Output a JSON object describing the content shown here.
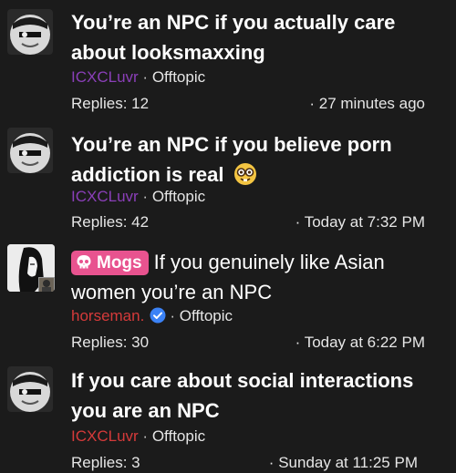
{
  "threads": [
    {
      "title": "You’re an NPC if you actually care about looksmaxxing",
      "author": "ICXCLuvr",
      "forum": "Offtopic",
      "replies": "Replies: 12",
      "time": "27 minutes ago"
    },
    {
      "title": "You’re an NPC if you believe porn addiction is real",
      "emoji": "nerd-face-emoji",
      "author": "ICXCLuvr",
      "forum": "Offtopic",
      "replies": "Replies: 42",
      "time": "Today at 7:32 PM"
    },
    {
      "prefix": "Mogs",
      "prefix_color": "#e8538f",
      "title": "If you genuinely like Asian women you’re an NPC",
      "author": "horseman.",
      "verified": true,
      "forum": "Offtopic",
      "replies": "Replies: 30",
      "time": "Today at 6:22 PM"
    },
    {
      "title": "If you care about social interactions you are an NPC",
      "author": "ICXCLuvr",
      "forum": "Offtopic",
      "replies": "Replies: 3",
      "time": "Sunday at 11:25 PM"
    }
  ],
  "separator": "·",
  "colors": {
    "background": "#1b1b1b",
    "username_red": "#d53a3a",
    "username_purple": "#8a3fb8",
    "badge": "#e8538f",
    "verified": "#3b82f6"
  }
}
